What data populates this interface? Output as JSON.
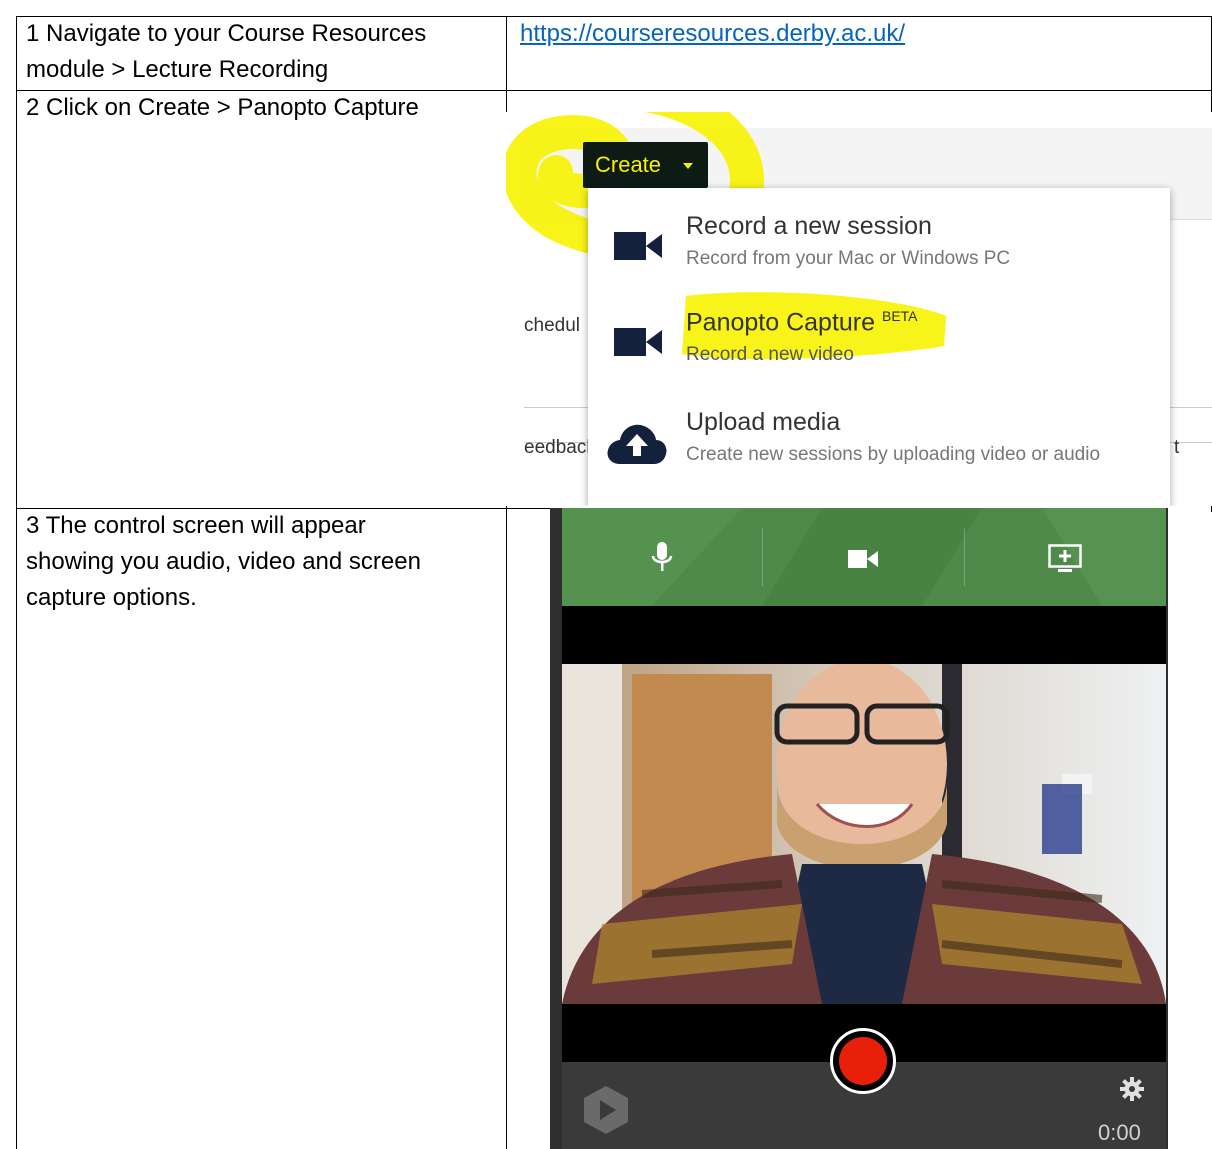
{
  "rows": [
    {
      "step": "1",
      "text_line1": "1 Navigate to your Course Resources",
      "text_line2": "module > Lecture Recording",
      "link": "https://courseresources.derby.ac.uk/"
    },
    {
      "step": "2",
      "text_line1": "2 Click on Create > Panopto Capture"
    },
    {
      "step": "3",
      "text_line1": "3 The control screen will appear",
      "text_line2": "showing you audio, video and screen",
      "text_line3": "capture options."
    }
  ],
  "create_menu": {
    "button_label": "Create",
    "behind_left_1": "chedul",
    "behind_left_2": "eedbacl",
    "behind_right": "t",
    "items": [
      {
        "title": "Record a new session",
        "subtitle": "Record from your Mac or Windows PC",
        "icon": "video-camera-icon"
      },
      {
        "title": "Panopto Capture",
        "badge": "BETA",
        "subtitle": "Record a new video",
        "icon": "video-camera-icon"
      },
      {
        "title": "Upload media",
        "subtitle": "Create new sessions by uploading video or audio",
        "icon": "cloud-upload-icon"
      }
    ],
    "highlight_color": "#f7f300"
  },
  "capture": {
    "toolbar": [
      "microphone-icon",
      "video-camera-icon",
      "screen-add-icon"
    ],
    "timer": "0:00",
    "record_color": "#e8200a",
    "toolbar_color": "#4f8a4a"
  }
}
